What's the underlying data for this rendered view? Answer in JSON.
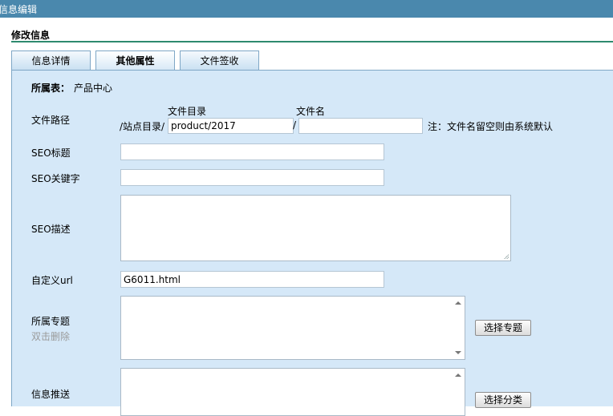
{
  "window": {
    "title": "信息编辑"
  },
  "section": {
    "title": "修改信息"
  },
  "tabs": [
    {
      "label": "信息详情",
      "active": false
    },
    {
      "label": "其他属性",
      "active": true
    },
    {
      "label": "文件签收",
      "active": false
    }
  ],
  "form": {
    "table_label": "所属表：",
    "table_value": "产品中心",
    "file_path_label": "文件路径",
    "dir_header": "文件目录",
    "filename_header": "文件名",
    "site_dir_prefix": "/站点目录/",
    "dir_value": "product/2017",
    "slash": "/",
    "filename_value": "",
    "filename_note": "注：文件名留空则由系统默认",
    "seo_title_label": "SEO标题",
    "seo_title_value": "",
    "seo_keywords_label": "SEO关键字",
    "seo_keywords_value": "",
    "seo_desc_label": "SEO描述",
    "seo_desc_value": "",
    "custom_url_label": "自定义url",
    "custom_url_value": "G6011.html",
    "topic_label": "所属专题",
    "topic_hint": "双击删除",
    "select_topic_button": "选择专题",
    "push_label": "信息推送",
    "select_category_button": "选择分类"
  }
}
